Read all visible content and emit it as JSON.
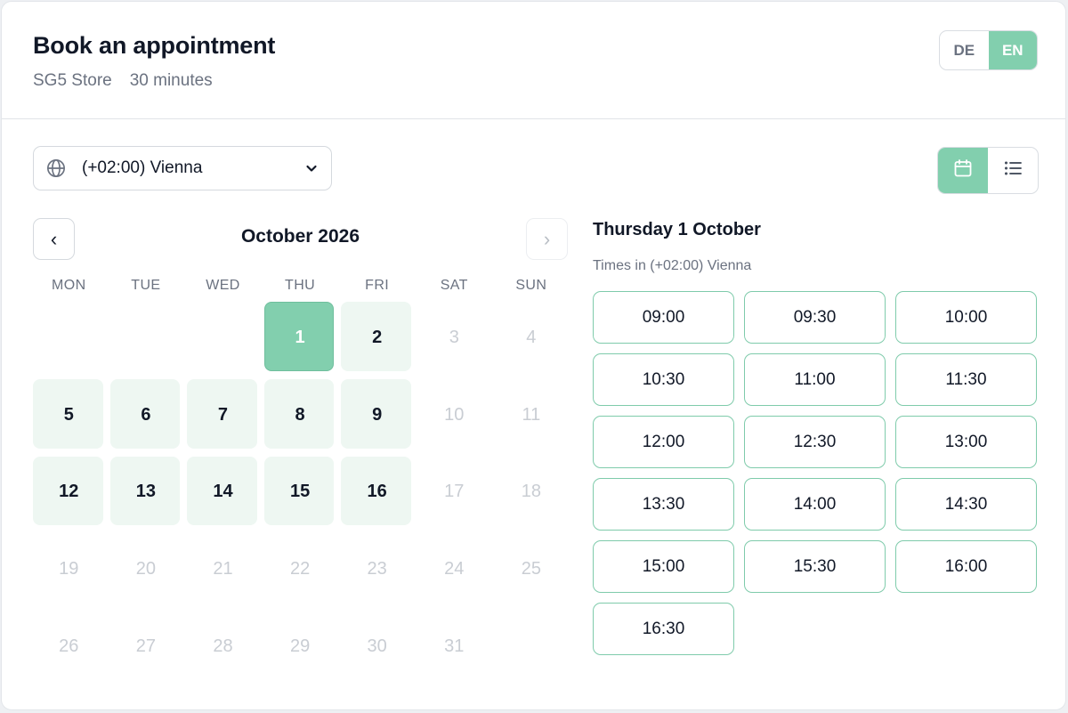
{
  "header": {
    "title": "Book an appointment",
    "store": "SG5 Store",
    "duration": "30 minutes"
  },
  "language": {
    "options": [
      "DE",
      "EN"
    ],
    "selected": "EN"
  },
  "timezone": {
    "label": "(+02:00) Vienna"
  },
  "view_toggle": {
    "selected": "calendar"
  },
  "calendar": {
    "month": "October 2026",
    "prev": "‹",
    "next": "›",
    "weekdays": [
      "MON",
      "TUE",
      "WED",
      "THU",
      "FRI",
      "SAT",
      "SUN"
    ],
    "leading_blanks": 3,
    "days": [
      {
        "d": "1",
        "state": "selected"
      },
      {
        "d": "2",
        "state": "avail"
      },
      {
        "d": "3",
        "state": "off"
      },
      {
        "d": "4",
        "state": "off"
      },
      {
        "d": "5",
        "state": "avail"
      },
      {
        "d": "6",
        "state": "avail"
      },
      {
        "d": "7",
        "state": "avail"
      },
      {
        "d": "8",
        "state": "avail"
      },
      {
        "d": "9",
        "state": "avail"
      },
      {
        "d": "10",
        "state": "off"
      },
      {
        "d": "11",
        "state": "off"
      },
      {
        "d": "12",
        "state": "avail"
      },
      {
        "d": "13",
        "state": "avail"
      },
      {
        "d": "14",
        "state": "avail"
      },
      {
        "d": "15",
        "state": "avail"
      },
      {
        "d": "16",
        "state": "avail"
      },
      {
        "d": "17",
        "state": "off"
      },
      {
        "d": "18",
        "state": "off"
      },
      {
        "d": "19",
        "state": "off"
      },
      {
        "d": "20",
        "state": "off"
      },
      {
        "d": "21",
        "state": "off"
      },
      {
        "d": "22",
        "state": "off"
      },
      {
        "d": "23",
        "state": "off"
      },
      {
        "d": "24",
        "state": "off"
      },
      {
        "d": "25",
        "state": "off"
      },
      {
        "d": "26",
        "state": "off"
      },
      {
        "d": "27",
        "state": "off"
      },
      {
        "d": "28",
        "state": "off"
      },
      {
        "d": "29",
        "state": "off"
      },
      {
        "d": "30",
        "state": "off"
      },
      {
        "d": "31",
        "state": "off"
      }
    ]
  },
  "slots_panel": {
    "date_title": "Thursday 1 October",
    "tz_note": "Times in (+02:00) Vienna",
    "times": [
      "09:00",
      "09:30",
      "10:00",
      "10:30",
      "11:00",
      "11:30",
      "12:00",
      "12:30",
      "13:00",
      "13:30",
      "14:00",
      "14:30",
      "15:00",
      "15:30",
      "16:00",
      "16:30"
    ]
  },
  "colors": {
    "accent": "#82cfae",
    "available_bg": "#eef7f2",
    "slot_border": "#7fcbab"
  }
}
